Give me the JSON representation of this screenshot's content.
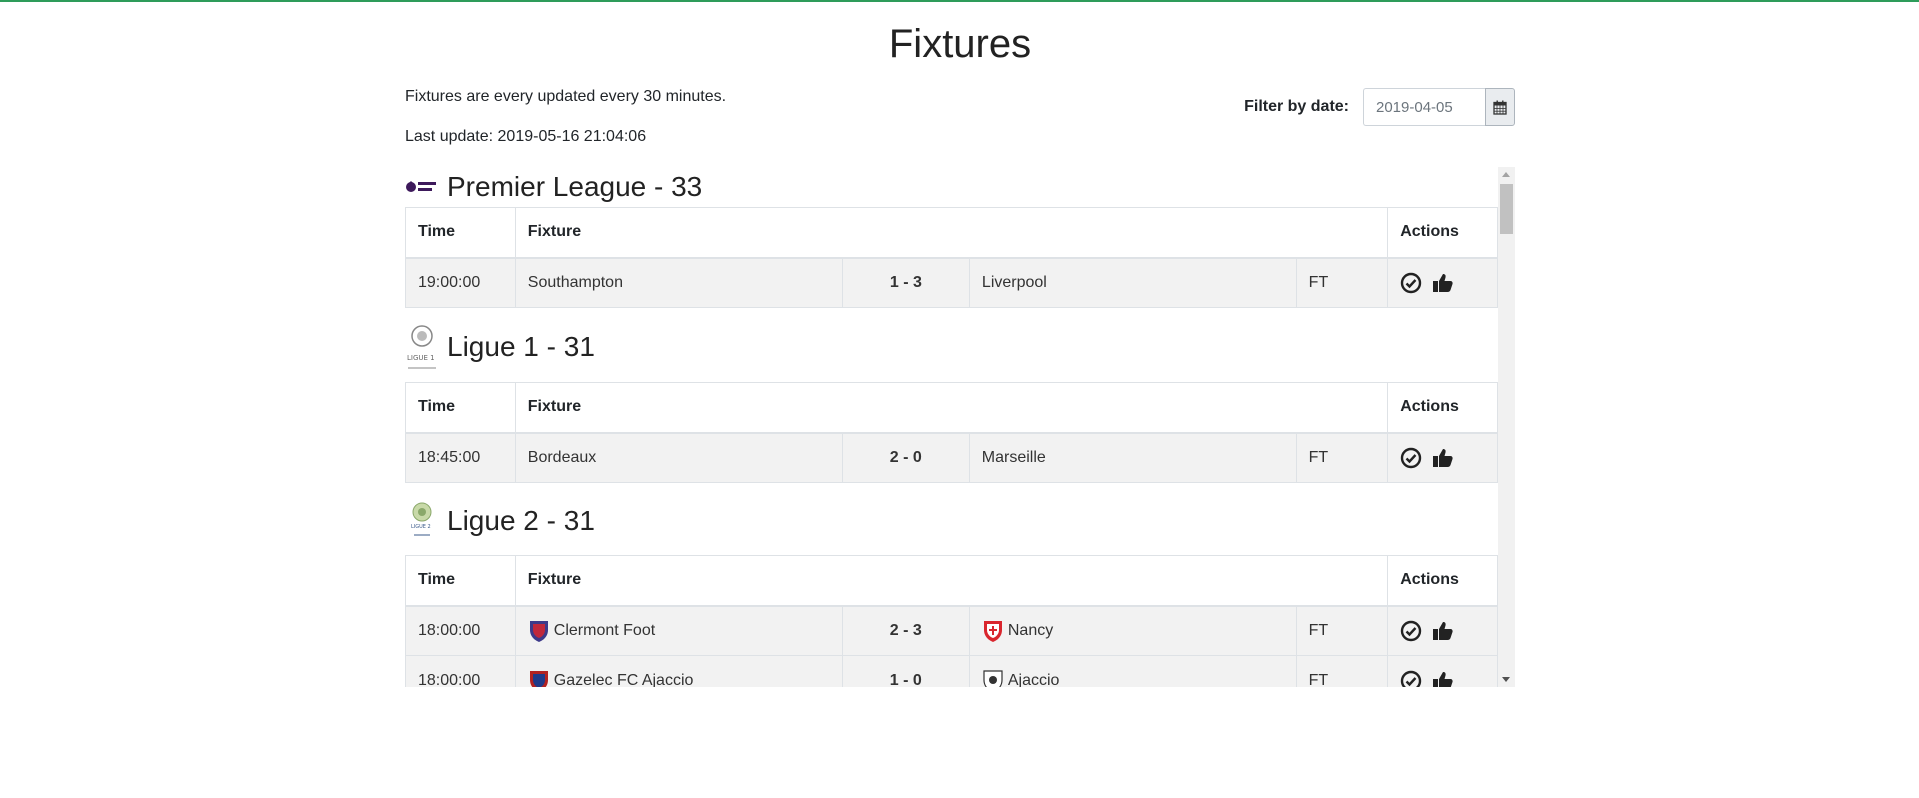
{
  "page": {
    "title": "Fixtures",
    "update_note": "Fixtures are every updated every 30 minutes.",
    "last_update": "Last update: 2019-05-16 21:04:06"
  },
  "filter": {
    "label": "Filter by date:",
    "value": "2019-04-05"
  },
  "table_headers": {
    "time": "Time",
    "fixture": "Fixture",
    "actions": "Actions"
  },
  "leagues": [
    {
      "name": "Premier League - 33",
      "fixtures": [
        {
          "time": "19:00:00",
          "home": "Southampton",
          "score": "1 - 3",
          "away": "Liverpool",
          "status": "FT"
        }
      ]
    },
    {
      "name": "Ligue 1 - 31",
      "fixtures": [
        {
          "time": "18:45:00",
          "home": "Bordeaux",
          "score": "2 - 0",
          "away": "Marseille",
          "status": "FT"
        }
      ]
    },
    {
      "name": "Ligue 2 - 31",
      "fixtures": [
        {
          "time": "18:00:00",
          "home": "Clermont Foot",
          "score": "2 - 3",
          "away": "Nancy",
          "status": "FT"
        },
        {
          "time": "18:00:00",
          "home": "Gazelec FC Ajaccio",
          "score": "1 - 0",
          "away": "Ajaccio",
          "status": "FT"
        }
      ]
    }
  ],
  "icons": {
    "calendar": "calendar-icon",
    "check": "check-circle-icon",
    "thumbs_up": "thumbs-up-icon"
  },
  "colors": {
    "accent": "#2e9c5a",
    "row_bg": "#f2f2f2"
  }
}
